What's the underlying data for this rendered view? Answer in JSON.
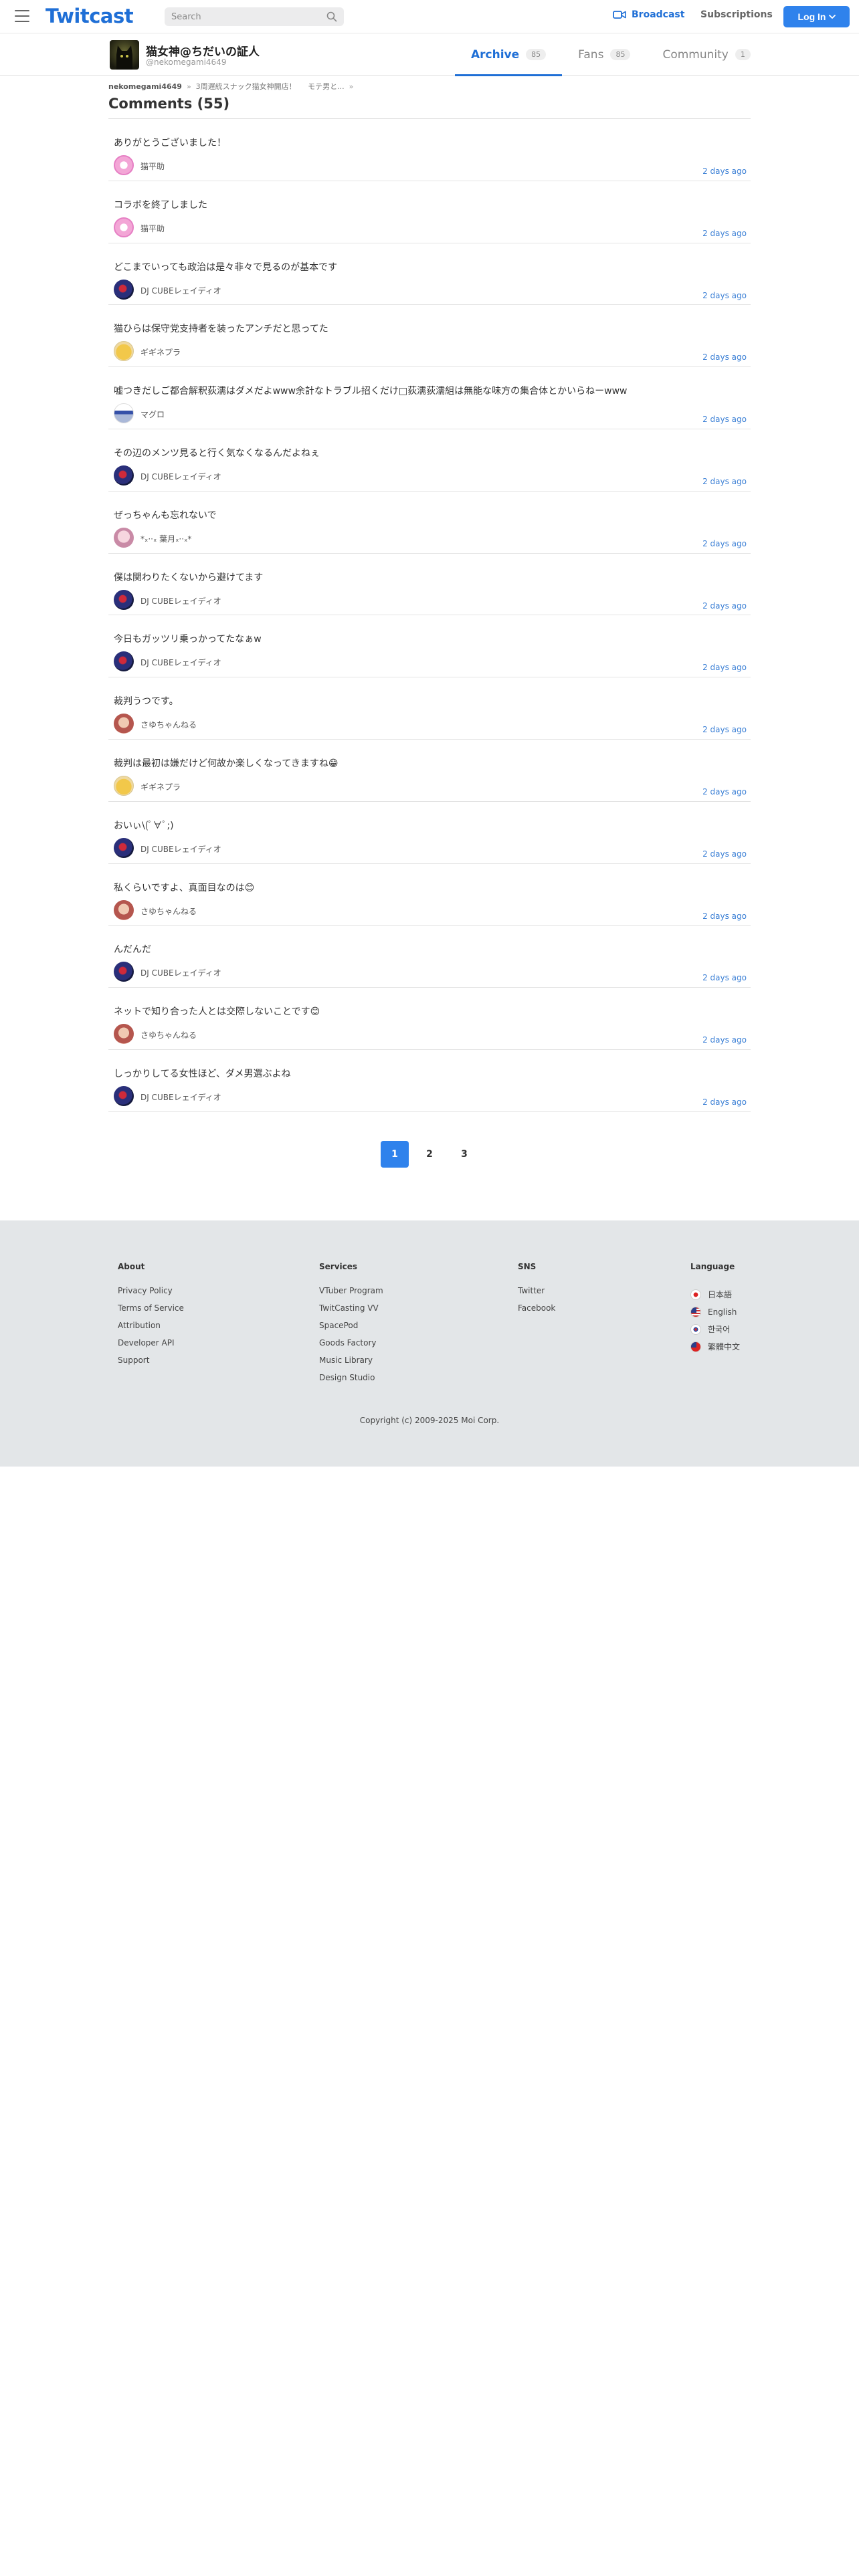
{
  "header": {
    "logo": "Twitcast",
    "search_placeholder": "Search",
    "broadcast": "Broadcast",
    "subscriptions": "Subscriptions",
    "login": "Log In"
  },
  "profile": {
    "name": "猫女神@ちだいの証人",
    "handle": "@nekomegami4649",
    "tabs": [
      {
        "label": "Archive",
        "count": "85"
      },
      {
        "label": "Fans",
        "count": "85"
      },
      {
        "label": "Community",
        "count": "1"
      }
    ]
  },
  "breadcrumb": {
    "root": "nekomegami4649",
    "item1": "3周遅統スナック猫女神開店！",
    "item2": "モテ男と..."
  },
  "page_title": "Comments (55)",
  "comments": [
    {
      "text": "ありがとうございました！",
      "user": "猫平助",
      "time": "2 days ago"
    },
    {
      "text": "コラボを終了しました",
      "user": "猫平助",
      "time": "2 days ago"
    },
    {
      "text": "どこまでいっても政治は是々非々で見るのが基本です",
      "user": "DJ CUBEレェイディオ",
      "time": "2 days ago"
    },
    {
      "text": "猫ひらは保守党支持者を装ったアンチだと思ってた",
      "user": "ギギネプラ",
      "time": "2 days ago"
    },
    {
      "text": "嘘つきだしご都合解釈荻濡はダメだよwww余計なトラブル招くだけ□荻濡荻濡組は無能な味方の集合体とかいらねーwww",
      "user": "マグロ",
      "time": "2 days ago"
    },
    {
      "text": "その辺のメンツ見ると行く気なくなるんだよねぇ",
      "user": "DJ CUBEレェイディオ",
      "time": "2 days ago"
    },
    {
      "text": "ぜっちゃんも忘れないで",
      "user": "*ₓ··ₓ 葉月ₓ··ₓ*",
      "time": "2 days ago"
    },
    {
      "text": "僕は関わりたくないから避けてます",
      "user": "DJ CUBEレェイディオ",
      "time": "2 days ago"
    },
    {
      "text": "今日もガッツリ乗っかってたなぁw",
      "user": "DJ CUBEレェイディオ",
      "time": "2 days ago"
    },
    {
      "text": "裁判うつです。",
      "user": "さゆちゃんねる",
      "time": "2 days ago"
    },
    {
      "text": "裁判は最初は嫌だけど何故か楽しくなってきますね😁",
      "user": "ギギネプラ",
      "time": "2 days ago"
    },
    {
      "text": "おいぃ\\(ﾟ∀ﾟ;)",
      "user": "DJ CUBEレェイディオ",
      "time": "2 days ago"
    },
    {
      "text": "私くらいですよ、真面目なのは😊",
      "user": "さゆちゃんねる",
      "time": "2 days ago"
    },
    {
      "text": "んだんだ",
      "user": "DJ CUBEレェイディオ",
      "time": "2 days ago"
    },
    {
      "text": "ネットで知り合った人とは交際しないことです😊",
      "user": "さゆちゃんねる",
      "time": "2 days ago"
    },
    {
      "text": "しっかりしてる女性ほど、ダメ男選ぶよね",
      "user": "DJ CUBEレェイディオ",
      "time": "2 days ago"
    }
  ],
  "pagination": [
    "1",
    "2",
    "3"
  ],
  "footer": {
    "about": {
      "title": "About",
      "links": [
        "Privacy Policy",
        "Terms of Service",
        "Attribution",
        "Developer API",
        "Support"
      ]
    },
    "services": {
      "title": "Services",
      "links": [
        "VTuber Program",
        "TwitCasting VV",
        "SpacePod",
        "Goods Factory",
        "Music Library",
        "Design Studio"
      ]
    },
    "sns": {
      "title": "SNS",
      "links": [
        "Twitter",
        "Facebook"
      ]
    },
    "language": {
      "title": "Language",
      "links": [
        "日本語",
        "English",
        "한국어",
        "繁體中文"
      ]
    },
    "copyright": "Copyright (c) 2009-2025 Moi Corp."
  },
  "colors": {
    "brand": "#1f6fd6",
    "button": "#2f82ec",
    "time": "#3a7fd5",
    "footer_bg": "#e3e6e8"
  }
}
